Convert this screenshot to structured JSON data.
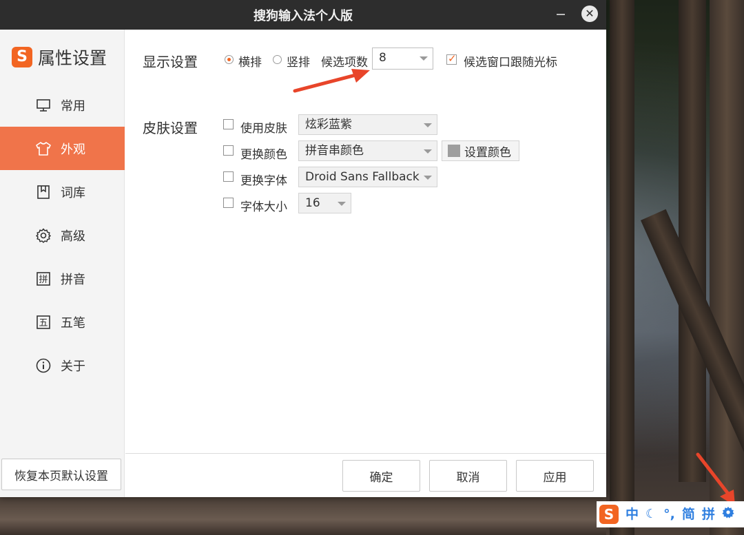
{
  "window": {
    "title": "搜狗输入法个人版"
  },
  "sidebar": {
    "brand_title": "属性设置",
    "items": [
      {
        "label": "常用",
        "icon": "monitor-icon"
      },
      {
        "label": "外观",
        "icon": "shirt-icon"
      },
      {
        "label": "词库",
        "icon": "dictionary-icon"
      },
      {
        "label": "高级",
        "icon": "gear-icon"
      },
      {
        "label": "拼音",
        "icon": "pinyin-icon"
      },
      {
        "label": "五笔",
        "icon": "wubi-icon"
      },
      {
        "label": "关于",
        "icon": "info-icon"
      }
    ],
    "active_item": "外观",
    "restore_label": "恢复本页默认设置"
  },
  "display": {
    "title": "显示设置",
    "horizontal_label": "横排",
    "vertical_label": "竖排",
    "selected_layout": "横排",
    "candidate_count_label": "候选项数",
    "candidate_count_value": "8",
    "follow_cursor_label": "候选窗口跟随光标",
    "follow_cursor_checked": true
  },
  "skin": {
    "title": "皮肤设置",
    "use_skin_label": "使用皮肤",
    "use_skin_value": "炫彩蓝紫",
    "change_color_label": "更换颜色",
    "change_color_value": "拼音串颜色",
    "set_color_label": "设置颜色",
    "change_font_label": "更换字体",
    "change_font_value": "Droid Sans Fallback",
    "font_size_label": "字体大小",
    "font_size_value": "16"
  },
  "footer": {
    "ok_label": "确定",
    "cancel_label": "取消",
    "apply_label": "应用"
  },
  "ime_bar": {
    "items": [
      "中",
      "☾",
      "°,",
      "简",
      "拼"
    ]
  },
  "colors": {
    "accent": "#f0744a",
    "brand": "#f26522",
    "titlebar": "#2d2d2d",
    "annotation_arrow": "#e8452a",
    "ime_text": "#2f7fe0"
  }
}
